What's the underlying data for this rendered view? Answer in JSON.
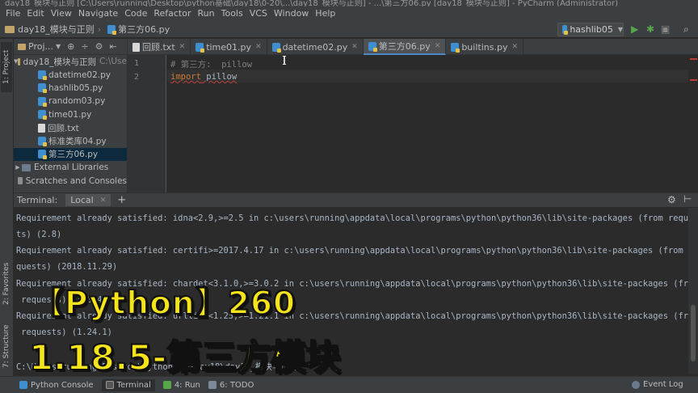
{
  "window": {
    "title": "day18_模块与正则 [C:\\Users\\running\\Desktop\\python基础\\day18\\0-20\\...\\day18_模块与正则] - ...\\第三方06.py [day18_模块与正则] - PyCharm (Administrator)"
  },
  "menu": [
    "File",
    "Edit",
    "View",
    "Navigate",
    "Code",
    "Refactor",
    "Run",
    "Tools",
    "VCS",
    "Window",
    "Help"
  ],
  "breadcrumb": {
    "project": "day18_模块与正则",
    "file": "第三方06.py"
  },
  "run_config": {
    "label": "hashlib05",
    "icons": [
      "run-icon",
      "debug-icon",
      "coverage-icon",
      "search-icon"
    ]
  },
  "left_strip": {
    "project": "1: Project",
    "favorites": "2: Favorites",
    "structure": "7: Structure"
  },
  "project_panel": {
    "header": "Proj...",
    "root": {
      "name": "day18_模块与正则",
      "path": "C:\\Use"
    },
    "files": [
      {
        "name": "datetime02.py",
        "kind": "py"
      },
      {
        "name": "hashlib05.py",
        "kind": "py"
      },
      {
        "name": "random03.py",
        "kind": "py"
      },
      {
        "name": "time01.py",
        "kind": "py"
      },
      {
        "name": "回顾.txt",
        "kind": "txt"
      },
      {
        "name": "标准类库04.py",
        "kind": "py"
      },
      {
        "name": "第三方06.py",
        "kind": "py",
        "selected": true
      }
    ],
    "external_libraries": "External Libraries",
    "scratches": "Scratches and Consoles"
  },
  "editor_tabs": [
    {
      "label": "回顾.txt",
      "kind": "txt"
    },
    {
      "label": "time01.py",
      "kind": "py"
    },
    {
      "label": "datetime02.py",
      "kind": "py"
    },
    {
      "label": "第三方06.py",
      "kind": "py",
      "active": true
    },
    {
      "label": "builtins.py",
      "kind": "py"
    }
  ],
  "code": {
    "line_numbers": [
      "1",
      "2"
    ],
    "line1": "# 第三方:  pillow",
    "line2_kw": "import",
    "line2_rest": " pillow"
  },
  "terminal": {
    "title": "Terminal:",
    "tab": "Local",
    "lines": [
      "Requirement already satisfied: idna<2.9,>=2.5 in c:\\users\\running\\appdata\\local\\programs\\python\\python36\\lib\\site-packages (from reques",
      "ts) (2.8)",
      "Requirement already satisfied: certifi>=2017.4.17 in c:\\users\\running\\appdata\\local\\programs\\python\\python36\\lib\\site-packages (from re",
      "quests) (2018.11.29)",
      "Requirement already satisfied: chardet<3.1.0,>=3.0.2 in c:\\users\\running\\appdata\\local\\programs\\python\\python36\\lib\\site-packages (from",
      " requests) (3.0.4)",
      "Requirement already satisfied: urllib3<1.25,>=1.21.1 in c:\\users\\running\\appdata\\local\\programs\\python\\python36\\lib\\site-packages (from",
      " requests) (1.24.1)",
      "",
      "C:\\Users\\running\\Desktop\\python基础\\day18\\day18_模块与正则>"
    ]
  },
  "overlay": {
    "line1": "【Python】260",
    "line2": "1.18.5-第三方模块"
  },
  "statusbar": {
    "python_console": "Python Console",
    "terminal": "Terminal",
    "run": "4: Run",
    "todo": "6: TODO",
    "event_log": "Event Log"
  },
  "colors": {
    "accent_blue": "#4a88c7",
    "overlay_yellow": "#f5e41a",
    "error_red": "#bc3f3c",
    "keyword_orange": "#cc7832"
  }
}
